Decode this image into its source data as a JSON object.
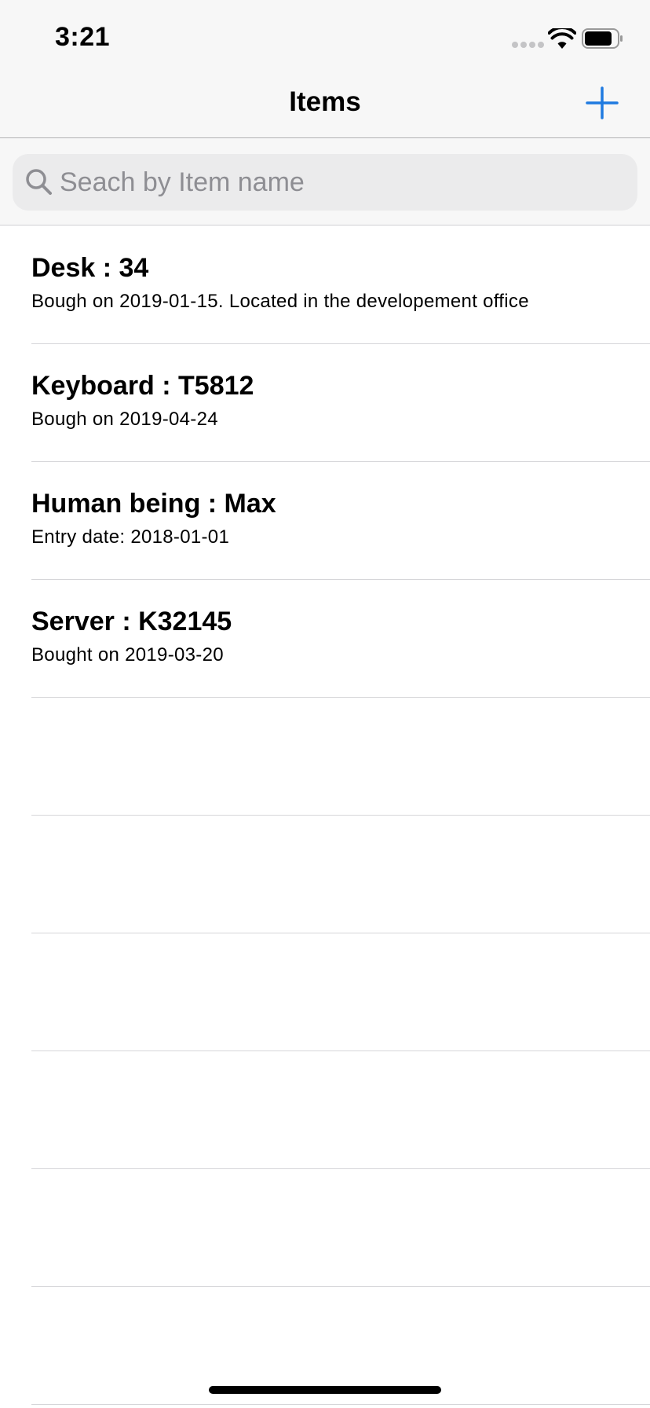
{
  "status_bar": {
    "time": "3:21"
  },
  "nav": {
    "title": "Items",
    "add_icon": "plus-icon"
  },
  "search": {
    "placeholder": "Seach by Item name",
    "value": ""
  },
  "items": [
    {
      "title": "Desk : 34",
      "subtitle": "Bough on 2019-01-15. Located in the developement office"
    },
    {
      "title": "Keyboard : T5812",
      "subtitle": "Bough on 2019-04-24"
    },
    {
      "title": "Human being : Max",
      "subtitle": "Entry date: 2018-01-01"
    },
    {
      "title": "Server : K32145",
      "subtitle": "Bought on 2019-03-20"
    }
  ],
  "colors": {
    "accent": "#1f7ae0",
    "nav_background": "#f7f7f7",
    "search_field": "#ebebec",
    "separator": "#d6d6d9"
  }
}
